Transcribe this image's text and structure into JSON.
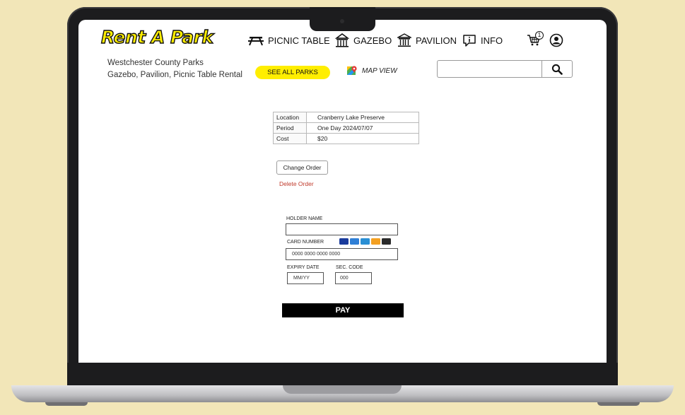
{
  "brand": {
    "logo_text": "Rent A Park",
    "accent": "#ffee00"
  },
  "nav": {
    "items": [
      {
        "label": "PICNIC TABLE",
        "icon": "picnic-table-icon"
      },
      {
        "label": "GAZEBO",
        "icon": "gazebo-icon"
      },
      {
        "label": "PAVILION",
        "icon": "pavilion-icon"
      },
      {
        "label": "INFO",
        "icon": "info-icon"
      }
    ],
    "cart_count": "1"
  },
  "header": {
    "subtitle_line1": "Westchester County Parks",
    "subtitle_line2": "Gazebo, Pavilion, Picnic Table Rental",
    "see_all_label": "SEE ALL PARKS",
    "map_view_label": "MAP VIEW",
    "search_value": ""
  },
  "order": {
    "rows": [
      {
        "key": "Location",
        "value": "Cranberry Lake Preserve"
      },
      {
        "key": "Period",
        "value": "One Day 2024/07/07"
      },
      {
        "key": "Cost",
        "value": "$20"
      }
    ],
    "change_label": "Change Order",
    "delete_label": "Delete Order",
    "delete_color": "#c0392b"
  },
  "payment": {
    "holder_label": "HOLDER NAME",
    "holder_value": "",
    "card_label": "CARD NUMBER",
    "card_placeholder": "0000 0000 0000 0000",
    "card_brands": [
      {
        "name": "visa",
        "color": "#1a3b9c"
      },
      {
        "name": "diners",
        "color": "#2f7fd6"
      },
      {
        "name": "amex",
        "color": "#2a8fd4"
      },
      {
        "name": "discover",
        "color": "#f4a021"
      },
      {
        "name": "mastercard",
        "color": "#2b2b2b"
      }
    ],
    "expiry_label": "EXPIRY DATE",
    "expiry_placeholder": "MM/YY",
    "sec_label": "SEC. CODE",
    "sec_placeholder": "000",
    "pay_label": "PAY"
  }
}
